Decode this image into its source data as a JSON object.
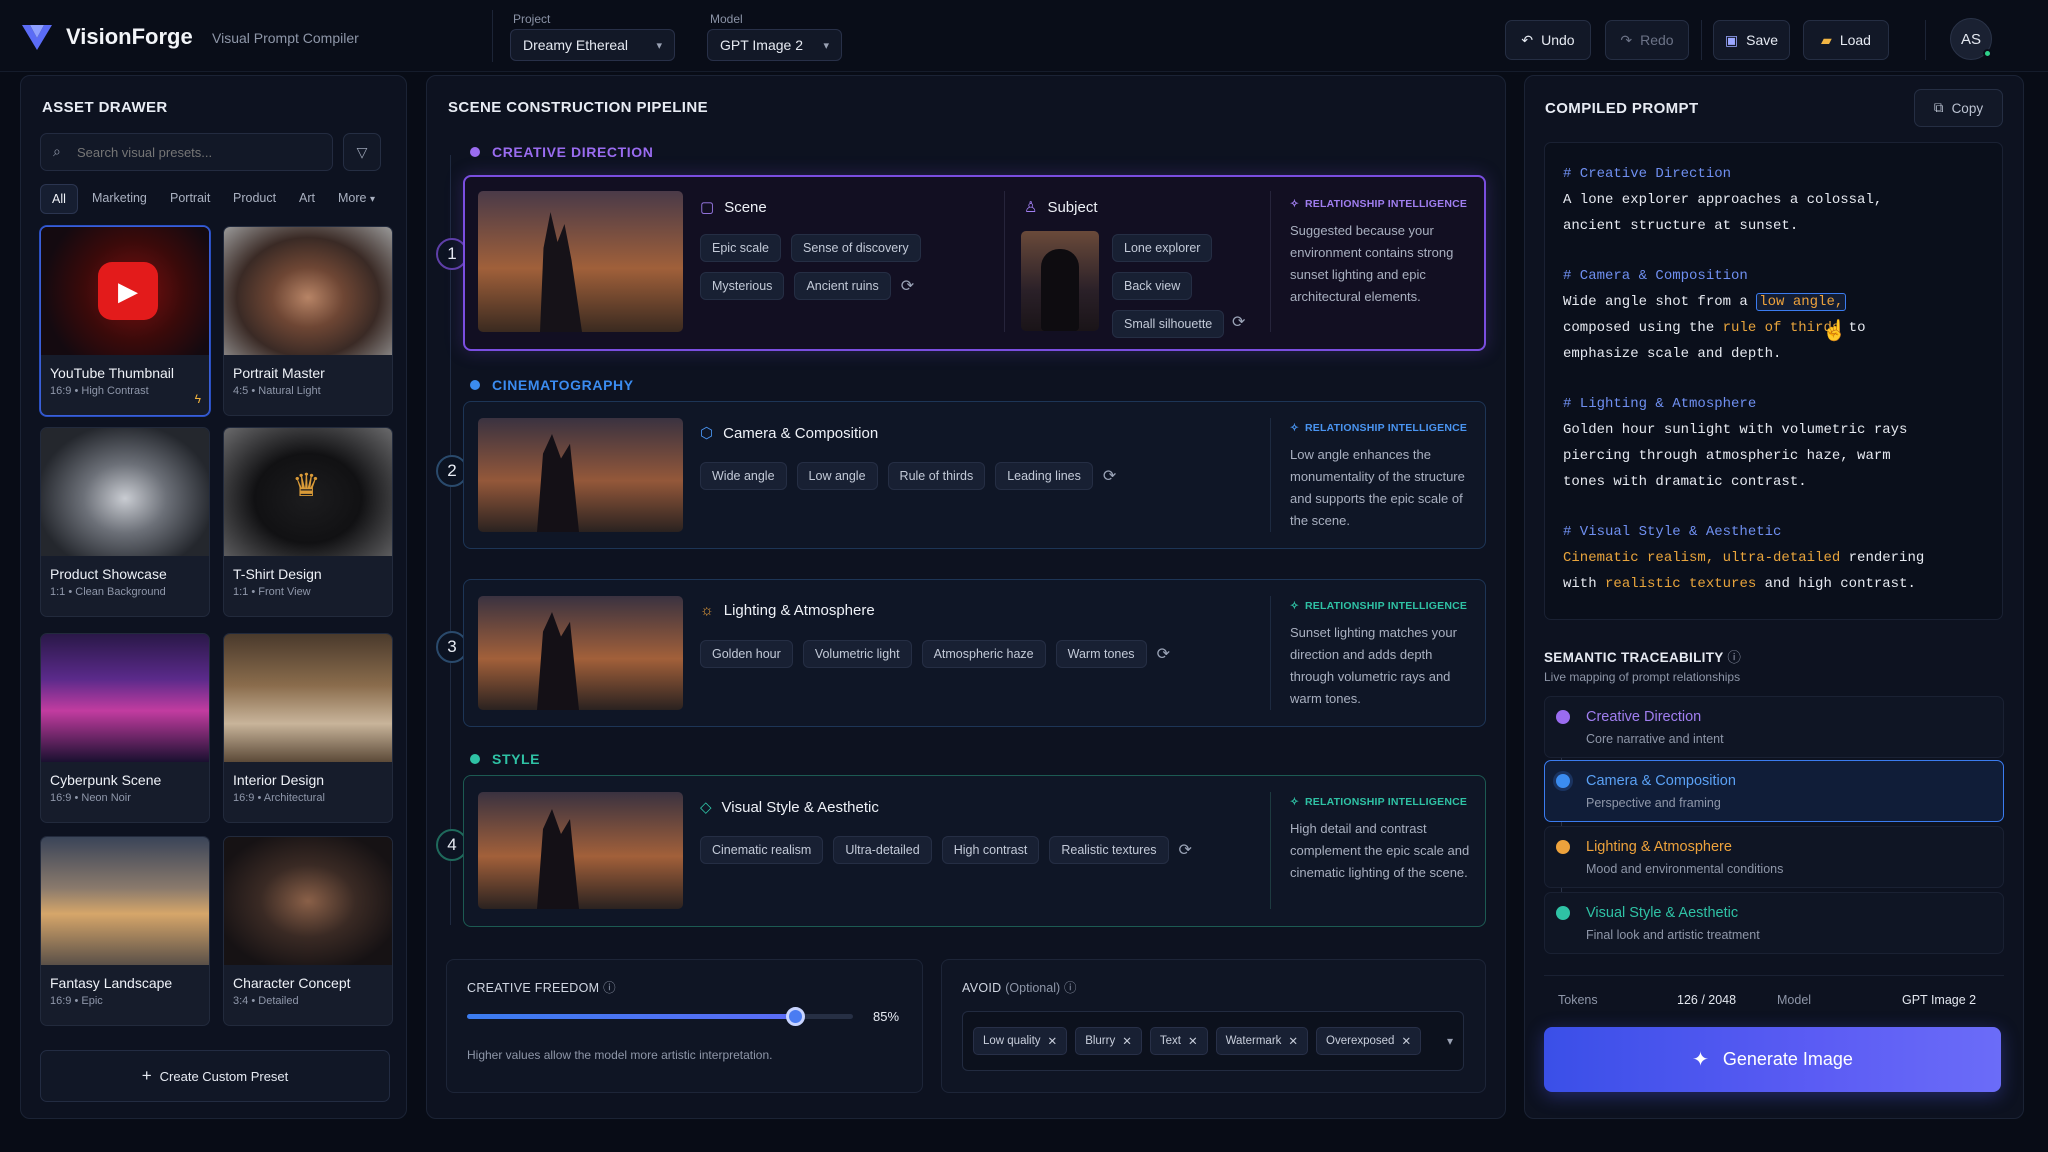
{
  "app": {
    "name": "VisionForge",
    "subtitle": "Visual Prompt Compiler",
    "avatar": "AS"
  },
  "header": {
    "project_label": "Project",
    "project_value": "Dreamy Ethereal",
    "model_label": "Model",
    "model_value": "GPT Image 2",
    "undo": "Undo",
    "redo": "Redo",
    "save": "Save",
    "load": "Load"
  },
  "drawer": {
    "title": "ASSET DRAWER",
    "search_placeholder": "Search visual presets...",
    "filters": [
      "All",
      "Marketing",
      "Portrait",
      "Product",
      "Art",
      "More"
    ],
    "presets": [
      {
        "title": "YouTube Thumbnail",
        "meta": "16:9 • High Contrast"
      },
      {
        "title": "Portrait Master",
        "meta": "4:5 • Natural Light"
      },
      {
        "title": "Product Showcase",
        "meta": "1:1 • Clean Background"
      },
      {
        "title": "T-Shirt Design",
        "meta": "1:1 • Front View"
      },
      {
        "title": "Cyberpunk Scene",
        "meta": "16:9 • Neon Noir"
      },
      {
        "title": "Interior Design",
        "meta": "16:9 • Architectural"
      },
      {
        "title": "Fantasy Landscape",
        "meta": "16:9 • Epic"
      },
      {
        "title": "Character Concept",
        "meta": "3:4 • Detailed"
      }
    ],
    "create_button": "Create Custom Preset"
  },
  "pipeline": {
    "title": "SCENE CONSTRUCTION PIPELINE",
    "stages": {
      "creative": "CREATIVE DIRECTION",
      "cinema": "CINEMATOGRAPHY",
      "style": "STYLE"
    },
    "ri_label": "RELATIONSHIP INTELLIGENCE",
    "step1": {
      "num": "1",
      "scene_title": "Scene",
      "scene_tags": [
        "Epic scale",
        "Sense of discovery",
        "Mysterious",
        "Ancient ruins"
      ],
      "subject_title": "Subject",
      "subject_tags": [
        "Lone explorer",
        "Back view",
        "Small silhouette"
      ],
      "ri": "Suggested because your environment contains strong sunset lighting and epic architectural elements."
    },
    "step2": {
      "num": "2",
      "title": "Camera & Composition",
      "tags": [
        "Wide angle",
        "Low angle",
        "Rule of thirds",
        "Leading lines"
      ],
      "ri": "Low angle enhances the monumentality of the structure and supports the epic scale of the scene."
    },
    "step3": {
      "num": "3",
      "title": "Lighting & Atmosphere",
      "tags": [
        "Golden hour",
        "Volumetric light",
        "Atmospheric haze",
        "Warm tones"
      ],
      "ri": "Sunset lighting matches your direction and adds depth through volumetric rays and warm tones."
    },
    "step4": {
      "num": "4",
      "title": "Visual Style & Aesthetic",
      "tags": [
        "Cinematic realism",
        "Ultra-detailed",
        "High contrast",
        "Realistic textures"
      ],
      "ri": "High detail and contrast complement the epic scale and cinematic lighting of the scene."
    },
    "freedom": {
      "label": "CREATIVE FREEDOM",
      "value": 0.85,
      "value_text": "85%",
      "hint": "Higher values allow the model more artistic interpretation."
    },
    "avoid": {
      "label": "AVOID",
      "optional": "(Optional)",
      "chips": [
        "Low quality",
        "Blurry",
        "Text",
        "Watermark",
        "Overexposed"
      ]
    }
  },
  "compiled": {
    "title": "COMPILED PROMPT",
    "copy": "Copy",
    "l1": "# Creative Direction",
    "l2": "A lone explorer approaches a colossal,",
    "l3": "ancient structure at sunset.",
    "l4": "# Camera & Composition",
    "l5a": "Wide angle shot from a ",
    "l5b": "low angle,",
    "l6a": "composed using the ",
    "l6b": "rule of thirds",
    "l6c": " to",
    "l7": "emphasize scale and depth.",
    "l8": "# Lighting & Atmosphere",
    "l9": "Golden hour sunlight with volumetric rays",
    "l10": "piercing through atmospheric haze, warm",
    "l11": "tones with dramatic contrast.",
    "l12": "# Visual Style & Aesthetic",
    "l13a": "Cinematic realism, ultra-detailed",
    "l13b": " rendering",
    "l14a": "with ",
    "l14b": "realistic textures",
    "l14c": " and high contrast."
  },
  "trace": {
    "title": "SEMANTIC TRACEABILITY",
    "subtitle": "Live mapping of prompt relationships",
    "items": [
      {
        "title": "Creative Direction",
        "sub": "Core narrative and intent",
        "color": "#9a6cf0"
      },
      {
        "title": "Camera & Composition",
        "sub": "Perspective and framing",
        "color": "#3b8cf0"
      },
      {
        "title": "Lighting & Atmosphere",
        "sub": "Mood and environmental conditions",
        "color": "#eda23c"
      },
      {
        "title": "Visual Style & Aesthetic",
        "sub": "Final look and artistic treatment",
        "color": "#2fc2a5"
      }
    ]
  },
  "footer": {
    "tokens_label": "Tokens",
    "tokens_value": "126 / 2048",
    "model_label": "Model",
    "model_value": "GPT Image 2",
    "generate": "Generate Image"
  }
}
